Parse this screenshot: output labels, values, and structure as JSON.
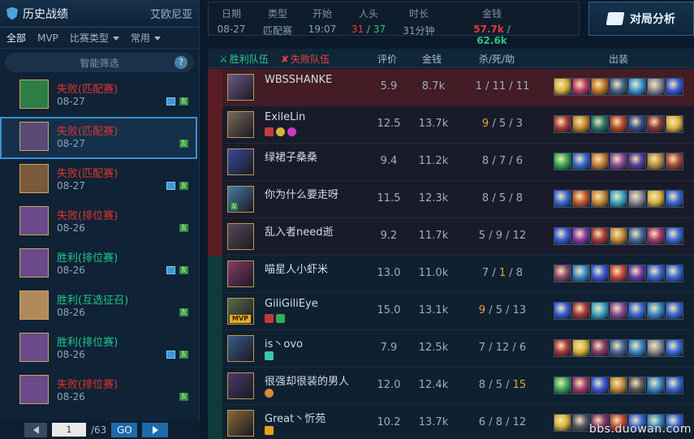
{
  "left_panel": {
    "title": "历史战绩",
    "server": "艾欧尼亚",
    "filters": [
      "全部",
      "MVP",
      "比赛类型",
      "常用"
    ],
    "smart_filter": "智能筛选",
    "help": "?",
    "matches": [
      {
        "result": "失败",
        "mode": "(匹配赛)",
        "date": "08-27",
        "win": false,
        "pic": true,
        "friend": "友",
        "avatar_color": "#2d7d46"
      },
      {
        "result": "失败",
        "mode": "(匹配赛)",
        "date": "08-27",
        "win": false,
        "pic": false,
        "friend": "友",
        "avatar_color": "#5a4a78"
      },
      {
        "result": "失败",
        "mode": "(匹配赛)",
        "date": "08-27",
        "win": false,
        "pic": true,
        "friend": "友",
        "avatar_color": "#7a5a3a"
      },
      {
        "result": "失败",
        "mode": "(排位赛)",
        "date": "08-26",
        "win": false,
        "pic": false,
        "friend": "友",
        "avatar_color": "#6a4a8a"
      },
      {
        "result": "胜利",
        "mode": "(排位赛)",
        "date": "08-26",
        "win": true,
        "pic": true,
        "friend": "友",
        "avatar_color": "#6a4a8a"
      },
      {
        "result": "胜利",
        "mode": "(互选征召)",
        "date": "08-26",
        "win": true,
        "pic": false,
        "friend": "友",
        "avatar_color": "#b08a5a"
      },
      {
        "result": "胜利",
        "mode": "(排位赛)",
        "date": "08-26",
        "win": true,
        "pic": true,
        "friend": "友",
        "avatar_color": "#6a4a8a"
      },
      {
        "result": "失败",
        "mode": "(排位赛)",
        "date": "08-26",
        "win": false,
        "pic": false,
        "friend": "友",
        "avatar_color": "#6a4a8a"
      }
    ],
    "pager": {
      "page": "1",
      "total": "/63",
      "go": "GO"
    }
  },
  "summary": {
    "date_label": "日期",
    "date": "08-27",
    "type_label": "类型",
    "type": "匹配赛",
    "start_label": "开始",
    "start": "19:07",
    "kills_label": "人头",
    "kills_red": "31",
    "kills_sep": "/",
    "kills_green": "37",
    "duration_label": "时长",
    "duration": "31分钟",
    "gold_label": "金钱",
    "gold_red": "57.7k",
    "gold_sep": "/",
    "gold_green": "62.6k"
  },
  "analysis_button": "对局分析",
  "table_headers": {
    "win_team": "胜利队伍",
    "lose_team": "失败队伍",
    "rating": "评价",
    "gold": "金钱",
    "kda": "杀/死/助",
    "items": "出装"
  },
  "players": [
    {
      "name": "WBSSHANKE",
      "rating": "5.9",
      "gold": "8.7k",
      "k": "1",
      "d": "11",
      "a": "11",
      "side": "red",
      "hl": "",
      "avatar": "#6b5a8a",
      "items": [
        "#d9b23a",
        "#c23a6a",
        "#c47a2a",
        "#4a6a8a",
        "#3a9ad8",
        "#8a8a9a",
        "#3a5ad8"
      ]
    },
    {
      "name": "ExileLin",
      "rating": "12.5",
      "gold": "13.7k",
      "k": "9",
      "d": "5",
      "a": "3",
      "side": "red",
      "hl": "gold-k",
      "avatar": "#7a6a5a",
      "items": [
        "#a83a3a",
        "#c48a2a",
        "#2a7a6a",
        "#b8482a",
        "#3a4a8a",
        "#8a3a3a",
        "#d9b23a"
      ]
    },
    {
      "name": "绿裙子桑桑",
      "rating": "9.4",
      "gold": "11.2k",
      "k": "8",
      "d": "7",
      "a": "6",
      "side": "red",
      "hl": "",
      "avatar": "#3a4a9a",
      "items": [
        "#3aa85a",
        "#3a6ad8",
        "#c47a3a",
        "#8a4a9a",
        "#5a3a9a",
        "#b8903a",
        "#a84a3a"
      ]
    },
    {
      "name": "你为什么要走呀",
      "rating": "11.5",
      "gold": "12.3k",
      "k": "8",
      "d": "5",
      "a": "8",
      "side": "red",
      "hl": "",
      "avatar": "#4a7aa8",
      "items": [
        "#3a6ad8",
        "#c45a2a",
        "#c48a3a",
        "#3aa8c8",
        "#8a8a9a",
        "#d9b23a",
        "#3a6ad8"
      ]
    },
    {
      "name": "乱入者need逝",
      "rating": "9.2",
      "gold": "11.7k",
      "k": "5",
      "d": "9",
      "a": "12",
      "side": "red",
      "hl": "",
      "avatar": "#5a4a5a",
      "items": [
        "#3a5ad8",
        "#8a3aa8",
        "#a83a3a",
        "#c48a3a",
        "#4a6a9a",
        "#a83a6a",
        "#3a6ad8"
      ]
    },
    {
      "name": "喵星人小虾米",
      "rating": "13.0",
      "gold": "11.0k",
      "k": "7",
      "d": "1",
      "a": "8",
      "side": "green",
      "hl": "d",
      "avatar": "#8a3a6a",
      "items": [
        "#8a4a6a",
        "#3a8ac8",
        "#3a5ad8",
        "#c4483a",
        "#6a3aa8",
        "#3a6ad8",
        "#3a6ad8"
      ]
    },
    {
      "name": "GiliGiliEye",
      "rating": "15.0",
      "gold": "13.1k",
      "k": "9",
      "d": "5",
      "a": "13",
      "side": "green",
      "hl": "rating-k",
      "avatar": "#5a6a4a",
      "items": [
        "#3a5ad8",
        "#a83a3a",
        "#3aa8c8",
        "#8a4a9a",
        "#3a6ad8",
        "#3a8ac8",
        "#3a6ad8"
      ]
    },
    {
      "name": "is丶ovo",
      "rating": "7.9",
      "gold": "12.5k",
      "k": "7",
      "d": "12",
      "a": "6",
      "side": "green",
      "hl": "",
      "avatar": "#3a5a8a",
      "items": [
        "#a83a3a",
        "#d9b23a",
        "#8a3a6a",
        "#4a6a9a",
        "#3a8ac8",
        "#8a8a9a",
        "#3a6ad8"
      ]
    },
    {
      "name": "很强却很装的男人",
      "rating": "12.0",
      "gold": "12.4k",
      "k": "8",
      "d": "5",
      "a": "15",
      "side": "green",
      "hl": "a",
      "avatar": "#4a3a6a",
      "items": [
        "#3aa85a",
        "#a83a6a",
        "#3a5ad8",
        "#c48a3a",
        "#5a5a5a",
        "#3a8ac8",
        "#3a6ad8"
      ]
    },
    {
      "name": "Great丶忻苑",
      "rating": "10.2",
      "gold": "13.7k",
      "k": "6",
      "d": "8",
      "a": "12",
      "side": "green",
      "hl": "",
      "avatar": "#8a6a3a",
      "items": [
        "#d9b23a",
        "#5a5a6a",
        "#8a3a6a",
        "#c4483a",
        "#3a6ad8",
        "#3a8ac8",
        "#3a6ad8"
      ]
    }
  ],
  "watermark": "bbs.duowan.com"
}
